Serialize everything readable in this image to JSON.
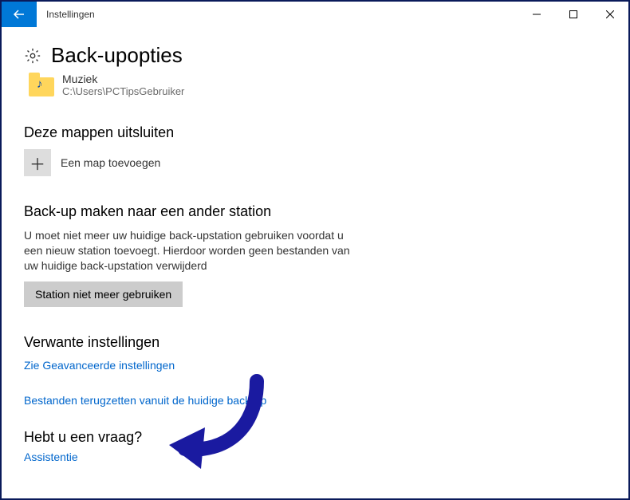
{
  "window": {
    "title": "Instellingen"
  },
  "page": {
    "title": "Back-upopties"
  },
  "folder": {
    "name": "Muziek",
    "path": "C:\\Users\\PCTipsGebruiker"
  },
  "exclude": {
    "heading": "Deze mappen uitsluiten",
    "addLabel": "Een map toevoegen"
  },
  "otherDrive": {
    "heading": "Back-up maken naar een ander station",
    "description": "U moet niet meer uw huidige back-upstation gebruiken voordat u een nieuw station toevoegt. Hierdoor worden geen bestanden van uw huidige back-upstation verwijderd",
    "buttonLabel": "Station niet meer gebruiken"
  },
  "related": {
    "heading": "Verwante instellingen",
    "link1": "Zie Geavanceerde instellingen",
    "link2": "Bestanden terugzetten vanuit de huidige back-up"
  },
  "help": {
    "heading": "Hebt u een vraag?",
    "link": "Assistentie"
  }
}
